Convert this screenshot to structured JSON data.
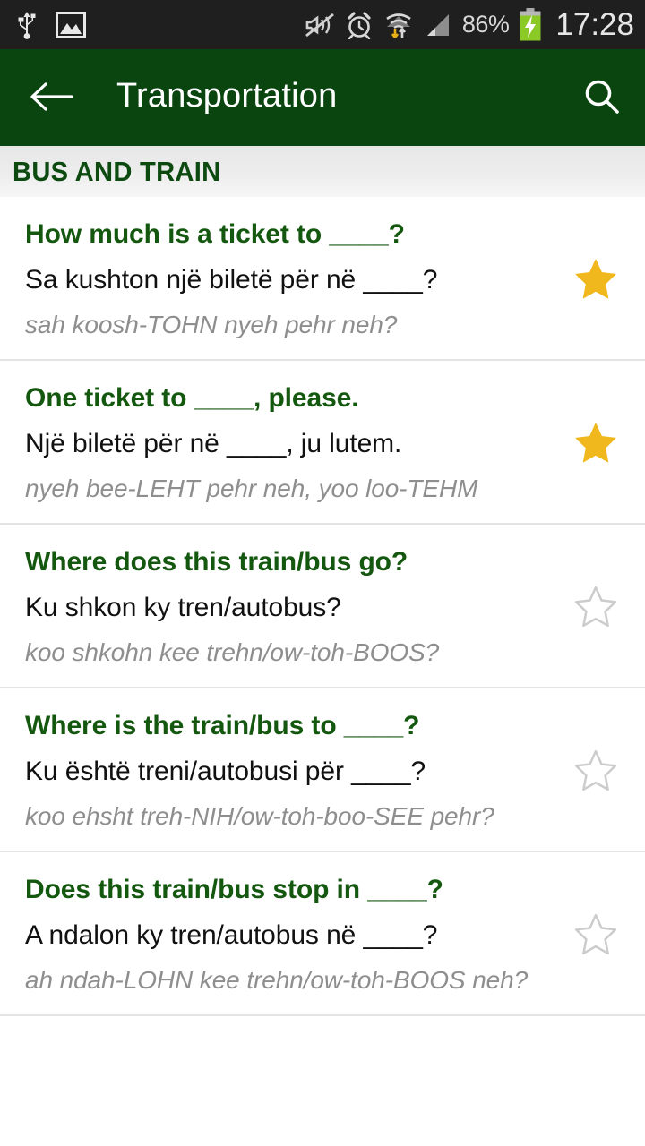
{
  "status_bar": {
    "icons_left": [
      "usb-icon",
      "screenshot-image-icon"
    ],
    "icons_right": [
      "vibrate-off-icon",
      "alarm-clock-icon",
      "wifi-transfer-icon",
      "signal-bars-icon"
    ],
    "battery_percent": "86%",
    "battery_state": "charging",
    "time": "17:28"
  },
  "app_bar": {
    "back_icon": "back-arrow-icon",
    "title": "Transportation",
    "search_icon": "search-icon",
    "background": "#0a4510"
  },
  "section": {
    "title": "BUS AND TRAIN"
  },
  "colors": {
    "brand_green": "#0a4510",
    "english_green": "#14580f",
    "translation_black": "#111111",
    "pronunciation_gray": "#8e8e8e",
    "star_filled": "#f0b81c",
    "star_empty": "#cccccc",
    "divider": "#e4e4e4"
  },
  "phrases": [
    {
      "english": "How much is a ticket to ____?",
      "translation": "Sa kushton një biletë për në ____?",
      "pronunciation": "sah koosh-TOHN nyeh pehr neh?",
      "favorite": true
    },
    {
      "english": "One ticket to ____, please.",
      "translation": "Një biletë për në ____, ju lutem.",
      "pronunciation": "nyeh bee-LEHT pehr neh, yoo loo-TEHM",
      "favorite": true
    },
    {
      "english": "Where does this train/bus go?",
      "translation": "Ku shkon ky tren/autobus?",
      "pronunciation": "koo shkohn kee trehn/ow-toh-BOOS?",
      "favorite": false
    },
    {
      "english": "Where is the train/bus to ____?",
      "translation": "Ku është treni/autobusi për ____?",
      "pronunciation": "koo ehsht treh-NIH/ow-toh-boo-SEE pehr?",
      "favorite": false
    },
    {
      "english": "Does this train/bus stop in ____?",
      "translation": "A ndalon ky tren/autobus në ____?",
      "pronunciation": "ah ndah-LOHN kee trehn/ow-toh-BOOS neh?",
      "favorite": false
    }
  ]
}
